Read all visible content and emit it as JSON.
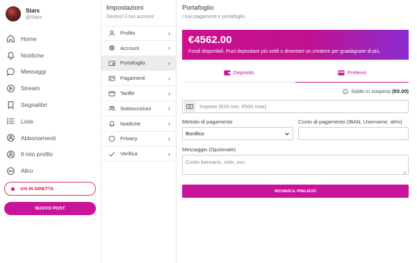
{
  "profile": {
    "name": "Starx",
    "handle": "@Starx"
  },
  "nav": {
    "items": [
      {
        "label": "Home",
        "icon": "home-icon"
      },
      {
        "label": "Notifiche",
        "icon": "bell-icon"
      },
      {
        "label": "Messaggi",
        "icon": "chat-icon"
      },
      {
        "label": "Stream",
        "icon": "play-icon"
      },
      {
        "label": "Segnalibri",
        "icon": "bookmark-icon"
      },
      {
        "label": "Liste",
        "icon": "list-icon"
      },
      {
        "label": "Abbonamenti",
        "icon": "user-star-icon"
      },
      {
        "label": "Il mio profilo",
        "icon": "user-circle-icon"
      },
      {
        "label": "Altro",
        "icon": "more-icon"
      }
    ],
    "live_label": "VAI IN DIRETTA",
    "new_post_label": "NUOVO POST"
  },
  "settings": {
    "title": "Impostazioni",
    "subtitle": "Gestisci il tuo account",
    "items": [
      {
        "label": "Profilo",
        "icon": "user-icon"
      },
      {
        "label": "Account",
        "icon": "gear-icon"
      },
      {
        "label": "Portafoglio",
        "icon": "wallet-icon",
        "active": true
      },
      {
        "label": "Pagamenti",
        "icon": "receipt-icon"
      },
      {
        "label": "Tariffe",
        "icon": "tag-icon"
      },
      {
        "label": "Sottoscrizioni",
        "icon": "users-icon"
      },
      {
        "label": "Notifiche",
        "icon": "bell-icon"
      },
      {
        "label": "Privacy",
        "icon": "shield-icon"
      },
      {
        "label": "Verifica",
        "icon": "check-icon"
      }
    ]
  },
  "wallet": {
    "title": "Portafoglio",
    "subtitle": "I tuoi pagamenti e portafoglio",
    "balance": "€4562.00",
    "balance_message": "Fondi disponibili. Puoi depositare più soldi o diventare un creatore per guadagnare di più.",
    "tab_deposit": "Deposito",
    "tab_withdraw": "Prelievo",
    "pending_label": "Saldo in sospeso",
    "pending_value": "(€0.00)",
    "amount_placeholder": "Importo (€20 min. €500 max)",
    "method_label": "Metodo di pagamento",
    "method_value": "Bonifico",
    "account_label": "Conto di pagamento (IBAN, Username, altro)",
    "message_label": "Messaggio (Opzionale)",
    "message_placeholder": "Conto bancario, note, ecc.",
    "submit_label": "RICHIEDI IL PRELIEVO"
  },
  "colors": {
    "accent": "#c9149a",
    "gradient_end": "#8b2bd0",
    "live": "#e0134a"
  }
}
